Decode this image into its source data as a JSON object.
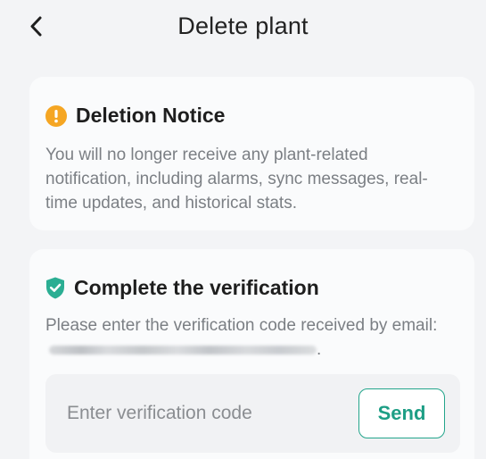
{
  "header": {
    "title": "Delete plant",
    "back_icon": "chevron-left-icon"
  },
  "notice": {
    "icon": "warning-circle-icon",
    "icon_color": "#f5a623",
    "title": "Deletion Notice",
    "body": "You will no longer receive any plant-related notification, including alarms, sync messages, real-time updates, and historical stats."
  },
  "verification": {
    "icon": "shield-check-icon",
    "icon_color": "#2bae93",
    "title": "Complete the verification",
    "body_prefix": "Please enter the verification code received by email:",
    "body_suffix": ".",
    "code_input": {
      "placeholder": "Enter verification code",
      "value": ""
    },
    "send_label": "Send",
    "accent_color": "#23a58b"
  }
}
